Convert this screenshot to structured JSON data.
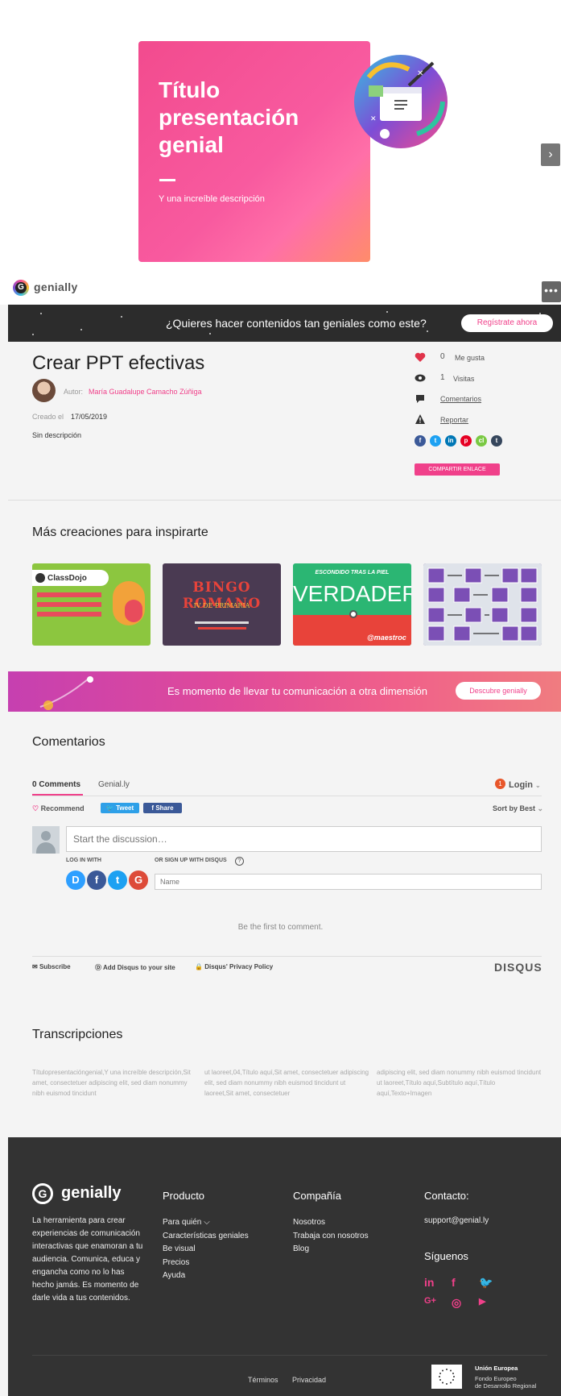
{
  "slide": {
    "title": "Título presentación genial",
    "description": "Y una increíble descripción",
    "next_label": "›"
  },
  "logo_bar": {
    "brand": "genially",
    "more_label": "•••"
  },
  "signup_banner": {
    "text": "¿Quieres hacer contenidos tan geniales como este?",
    "button": "Regístrate ahora"
  },
  "creation": {
    "title": "Crear PPT efectivas",
    "author_label": "Autor:",
    "author_name": "María Guadalupe Camacho Zúñiga",
    "created_label": "Creado el",
    "created_date": "17/05/2019",
    "description": "Sin descripción"
  },
  "stats": {
    "likes_count": "0",
    "likes_label": "Me gusta",
    "visits_count": "1",
    "visits_label": "Visitas",
    "comments_link": "Comentarios",
    "report_link": "Reportar",
    "share_link_button": "COMPARTIR ENLACE"
  },
  "share_icons": [
    {
      "label": "f",
      "color": "#3b5998"
    },
    {
      "label": "t",
      "color": "#1da1f2"
    },
    {
      "label": "in",
      "color": "#0077b5"
    },
    {
      "label": "p",
      "color": "#e60023"
    },
    {
      "label": "cl",
      "color": "#7ac943"
    },
    {
      "label": "t",
      "color": "#35465c"
    }
  ],
  "more_creations": {
    "title": "Más creaciones para inspirarte",
    "thumbs": [
      {
        "label": "ClassDojo"
      },
      {
        "label": "BINGO ROMANO",
        "sub": "IV DE PRIMARIA"
      },
      {
        "label": "VERDADERO",
        "sub": "ESCONDIDO TRAS LA PIEL",
        "handle": "@maestroc"
      },
      {
        "label": ""
      }
    ]
  },
  "discover_banner": {
    "text": "Es momento de llevar tu comunicación a otra dimensión",
    "button": "Descubre genially"
  },
  "comments": {
    "title": "Comentarios",
    "tab_count": "0 Comments",
    "tab_site": "Genial.ly",
    "login": "Login",
    "recommend": "Recommend",
    "tweet": "Tweet",
    "share": "Share",
    "sort": "Sort by Best",
    "placeholder": "Start the discussion…",
    "log_in_with": "LOG IN WITH",
    "sign_up_with": "OR SIGN UP WITH DISQUS",
    "help": "?",
    "name_placeholder": "Name",
    "auth_buttons": [
      {
        "label": "D",
        "color": "#2e9fff"
      },
      {
        "label": "f",
        "color": "#3b5998"
      },
      {
        "label": "t",
        "color": "#1da1f2"
      },
      {
        "label": "G",
        "color": "#dd4b39"
      }
    ],
    "empty_text": "Be the first to comment.",
    "subscribe": "Subscribe",
    "add_disqus": "Add Disqus to your site",
    "privacy": "Disqus' Privacy Policy",
    "disqus_logo": "DISQUS"
  },
  "transcripts": {
    "title": "Transcripciones",
    "columns": [
      "Títulopresentacióngenial,Y una increíble descripción,Sit amet, consectetuer adipiscing elit, sed diam nonummy nibh euismod tincidunt",
      "ut laoreet,04,Título aquí,Sit amet, consectetuer adipiscing elit, sed diam nonummy nibh euismod tincidunt ut laoreet,Sit amet, consectetuer",
      "adipiscing elit, sed diam nonummy nibh euismod tincidunt ut laoreet,Título aquí,Subtítulo aquí,Título aquí,Texto+Imagen"
    ]
  },
  "footer": {
    "brand": "genially",
    "tagline": "La herramienta para crear experiencias de comunicación interactivas que enamoran a tu audiencia. Comunica, educa y engancha como no lo has hecho jamás. Es momento de darle vida a tus contenidos.",
    "product_heading": "Producto",
    "product_items": [
      "Para quién ⌵",
      "Características geniales",
      "Be visual",
      "Precios",
      "Ayuda"
    ],
    "company_heading": "Compañía",
    "company_items": [
      "Nosotros",
      "Trabaja con nosotros",
      "Blog"
    ],
    "contact_heading": "Contacto:",
    "contact_email": "support@genial.ly",
    "follow_heading": "Síguenos",
    "follow_icons": [
      "in",
      "f",
      "🐦",
      "G+",
      "◎",
      "▶"
    ],
    "terms": "Términos",
    "privacy": "Privacidad",
    "eu_title": "Unión Europea",
    "eu_line1": "Fondo Europeo",
    "eu_line2": "de Desarrollo Regional"
  }
}
